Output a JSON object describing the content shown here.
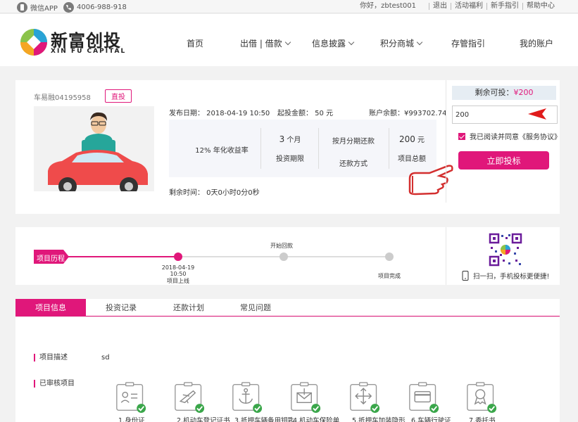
{
  "topbar": {
    "wechat_app": "微信APP",
    "phone": "4006-988-918",
    "greeting": "你好，zbtest001",
    "links": [
      "退出",
      "活动福利",
      "新手指引",
      "帮助中心"
    ]
  },
  "header": {
    "logo_cn": "新富创投",
    "logo_en": "XIN FU CAPITAL",
    "nav": [
      {
        "label": "首页",
        "dropdown": false
      },
      {
        "label": "出借 | 借款",
        "dropdown": true
      },
      {
        "label": "信息披露",
        "dropdown": true
      },
      {
        "label": "积分商城",
        "dropdown": true
      },
      {
        "label": "存管指引",
        "dropdown": false
      },
      {
        "label": "我的账户",
        "dropdown": false
      }
    ]
  },
  "project": {
    "name": "车易融04195958",
    "badge": "直投",
    "publish_date": "发布日期： 2018-04-19 10:50",
    "min_amount": "起投金额：  50 元",
    "balance": "账户余额：¥993702.74",
    "rate_value": "12%",
    "rate_label": "年化收益率",
    "term_value": "3",
    "term_unit": "个月",
    "term_label": "投资期限",
    "repay_value": "按月分期还款",
    "repay_label": "还款方式",
    "total_value": "200",
    "total_unit": "元",
    "total_label": "项目总额",
    "remaining_time": "剩余时间： 0天0小时0分0秒"
  },
  "invest": {
    "avail_label": "剩余可投：",
    "avail_value": "¥200",
    "amount": "200",
    "agree_text": "我已阅读并同意《服务协议》",
    "button": "立即投标"
  },
  "history": {
    "title": "项目历程",
    "step1_date": "2018-04-19 10:50",
    "step1_label": "项目上线",
    "step2_label": "开始回款",
    "step3_label": "项目完成",
    "scan_text": "扫一扫，手机投标更便捷!"
  },
  "tabs": [
    "项目信息",
    "投资记录",
    "还款计划",
    "常见问题"
  ],
  "info": {
    "desc_label": "项目描述",
    "desc_value": "sd",
    "audited_label": "已审核项目",
    "docs": [
      "1.身份证",
      "2.机动车登记证书",
      "3.抵押车辆备用钥匙",
      "4.机动车保险单",
      "5.抵押车加装隐形",
      "6.车辆行驶证",
      "7.委托书"
    ]
  },
  "colors": {
    "accent": "#e0177a",
    "check": "#3aa64a"
  }
}
